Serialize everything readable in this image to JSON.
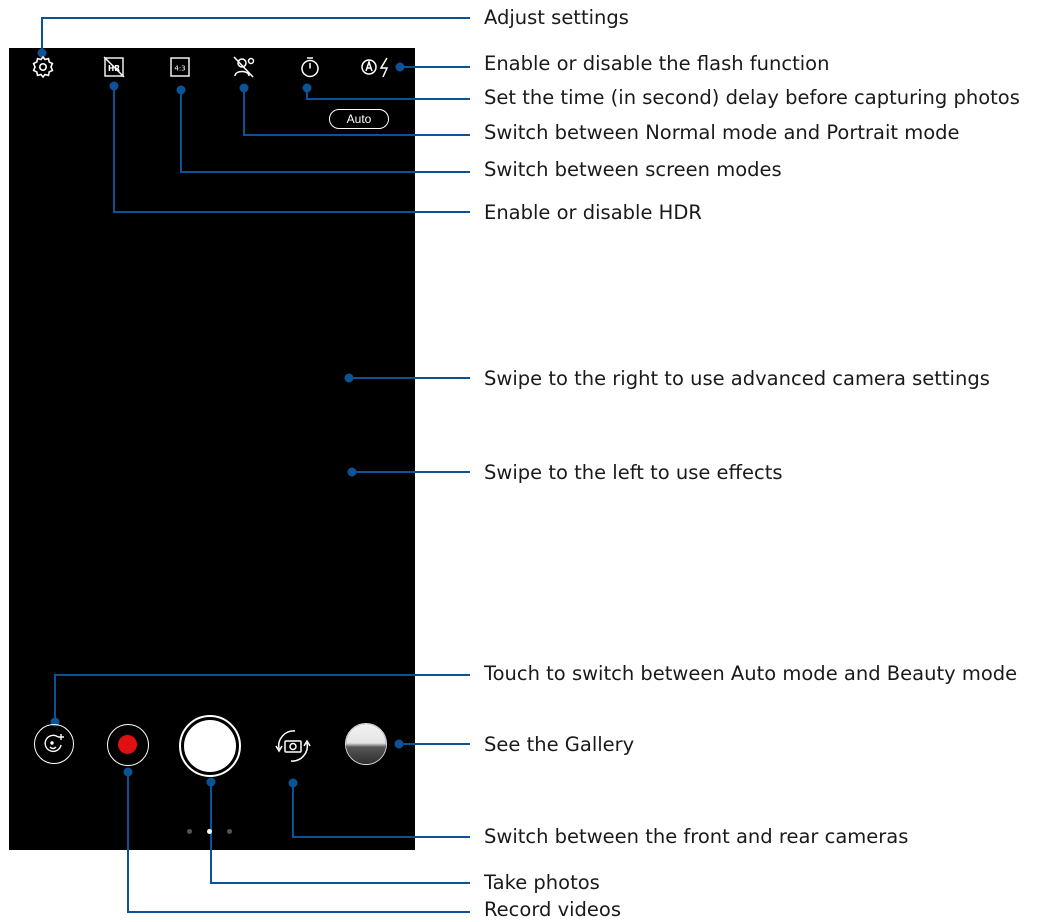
{
  "camera": {
    "flash_mode_label": "Auto"
  },
  "colors": {
    "leader_line": "#0b5394",
    "screen_bg": "#000000",
    "record_red": "#e01010"
  },
  "callouts": [
    {
      "id": "adjust-settings",
      "text": "Adjust settings"
    },
    {
      "id": "flash",
      "text": "Enable or disable the flash function"
    },
    {
      "id": "timer",
      "text": "Set the time (in second) delay before capturing photos"
    },
    {
      "id": "portrait",
      "text": "Switch between Normal mode and Portrait mode"
    },
    {
      "id": "screen-modes",
      "text": "Switch between screen modes"
    },
    {
      "id": "hdr",
      "text": "Enable or disable HDR"
    },
    {
      "id": "advanced",
      "text": "Swipe to the right to use advanced camera settings"
    },
    {
      "id": "effects",
      "text": "Swipe to the left to use effects"
    },
    {
      "id": "beauty",
      "text": "Touch to switch between Auto mode and Beauty mode"
    },
    {
      "id": "gallery",
      "text": "See the Gallery"
    },
    {
      "id": "switch-camera",
      "text": "Switch between the front and rear cameras"
    },
    {
      "id": "take-photos",
      "text": "Take photos"
    },
    {
      "id": "record-videos",
      "text": "Record videos"
    }
  ],
  "icons": {
    "settings": "gear-icon",
    "hdr": "hdr-off-icon",
    "aspect": "aspect-ratio-icon",
    "portrait": "portrait-off-icon",
    "timer": "timer-icon",
    "flash": "flash-auto-icon",
    "beauty": "beauty-mode-icon",
    "record": "record-icon",
    "shutter": "shutter-icon",
    "switch_camera": "switch-camera-icon",
    "gallery": "gallery-thumbnail-icon"
  }
}
